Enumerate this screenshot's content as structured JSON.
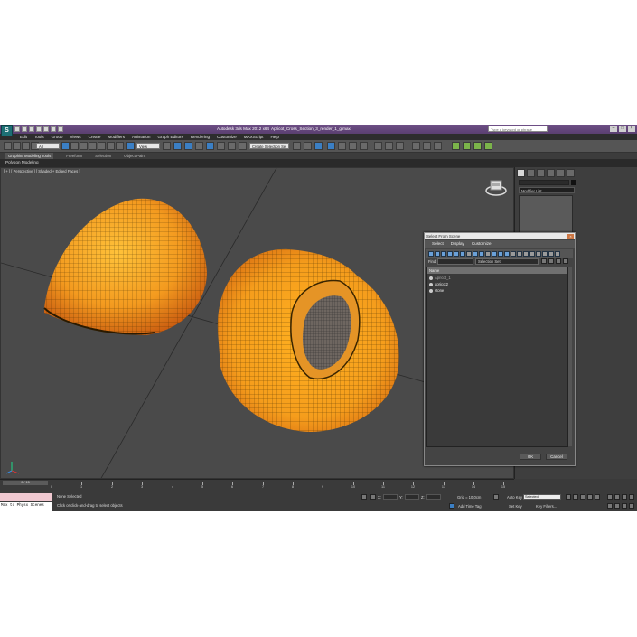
{
  "title": {
    "app": "Autodesk 3ds Max 2012 x64",
    "file": "Apricot_Cross_Section_3_render_1_g.max",
    "search_placeholder": "Type a keyword or phrase"
  },
  "menu": [
    "Edit",
    "Tools",
    "Group",
    "Views",
    "Create",
    "Modifiers",
    "Animation",
    "Graph Editors",
    "Rendering",
    "Customize",
    "MAXScript",
    "Help"
  ],
  "toolbar": {
    "selection_filter": "All",
    "view_dropdown": "View",
    "named_selection": "Create Selection Se"
  },
  "ribbon": {
    "tabs": [
      "Graphite Modeling Tools",
      "Freeform",
      "Selection",
      "Object Paint"
    ],
    "active_sub": "Polygon Modeling"
  },
  "viewport": {
    "label": "[ + ] [ Perspective ] [ Shaded + Edged Faces ]"
  },
  "command_panel": {
    "modifier_list": "Modifier List"
  },
  "dialog": {
    "title": "Select From Scene",
    "menu": [
      "Select",
      "Display",
      "Customize"
    ],
    "find_label": "Find:",
    "selection_set_label": "Selection Set:",
    "column_header": "Name",
    "rows": [
      "Apricot_1",
      "apricot2",
      "stone"
    ],
    "ok": "OK",
    "cancel": "Cancel"
  },
  "timeline": {
    "slider": "0 / 15",
    "ticks": [
      "0",
      "1",
      "2",
      "3",
      "4",
      "5",
      "6",
      "7",
      "8",
      "9",
      "10",
      "11",
      "12",
      "13",
      "14",
      "15"
    ]
  },
  "status": {
    "maxscript": "Max to Physx Scenes",
    "selection": "None Selected",
    "prompt": "Click or click-and-drag to select objects",
    "grid": "Grid = 10,0cm",
    "auto_key": "Auto Key",
    "selected": "Selected",
    "set_key": "Set Key",
    "key_filters": "Key Filters...",
    "add_time_tag": "Add Time Tag"
  },
  "colors": {
    "titlebar": "#5f4475",
    "accent_blue": "#3b7fc4",
    "apricot": "#f5a623",
    "viewport": "#4a4a4a"
  }
}
